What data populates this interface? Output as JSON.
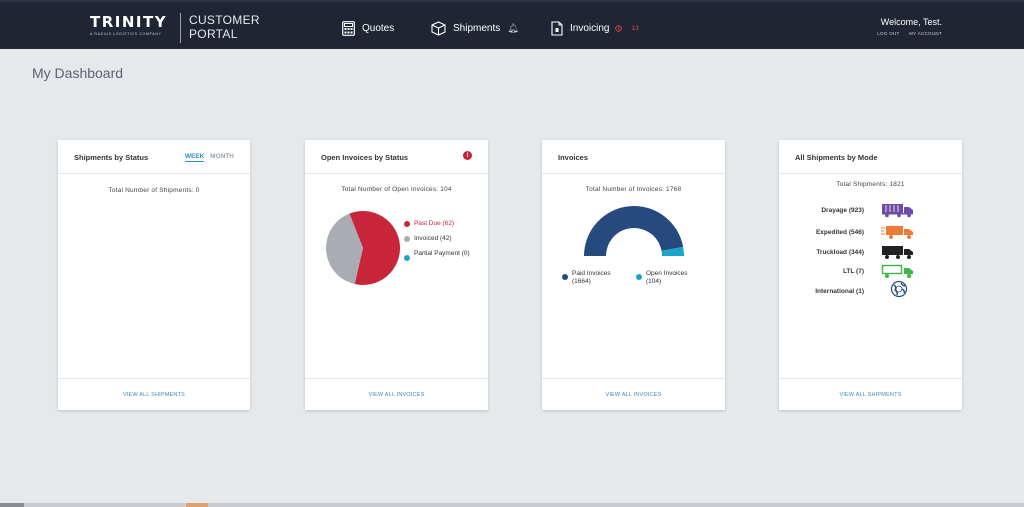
{
  "header": {
    "logo_word": "TRINITY",
    "logo_tagline": "A RADIUS LOGISTICS COMPANY",
    "portal_line1": "CUSTOMER",
    "portal_line2": "PORTAL",
    "nav": [
      {
        "label": "Quotes",
        "icon": "calculator-icon"
      },
      {
        "label": "Shipments",
        "icon": "box-icon"
      },
      {
        "label": "Invoicing",
        "icon": "document-icon",
        "badge": "13"
      }
    ],
    "welcome": "Welcome, Test.",
    "logout": "LOG OUT",
    "my_account": "MY ACCOUNT"
  },
  "page": {
    "title": "My Dashboard"
  },
  "cards": {
    "shipments_status": {
      "title": "Shipments by Status",
      "tab_week": "WEEK",
      "tab_month": "MONTH",
      "active_tab": "WEEK",
      "total": "Total Number of Shipments: 0",
      "footer": "VIEW ALL SHIPMENTS"
    },
    "open_invoices": {
      "title": "Open Invoices by Status",
      "alert": "!",
      "total": "Total Number of Open Invoices: 104",
      "legend": [
        {
          "label": "Past Due (62)",
          "color": "#c8243a"
        },
        {
          "label": "Invoiced (42)",
          "color": "#a9adb3"
        },
        {
          "label": "Partial Payment (0)",
          "color": "#1ba6c9"
        }
      ],
      "footer": "VIEW ALL INVOICES"
    },
    "invoices": {
      "title": "Invoices",
      "total": "Total Number of Invoices: 1768",
      "legend": [
        {
          "label": "Paid Invoices (1664)",
          "color": "#264a7e"
        },
        {
          "label": "Open Invoices (104)",
          "color": "#1ba6c9"
        }
      ],
      "footer": "VIEW ALL INVOICES"
    },
    "shipments_mode": {
      "title": "All Shipments by Mode",
      "total": "Total Shipments: 1821",
      "modes": [
        {
          "label": "Drayage (923)",
          "icon": "container-truck-icon",
          "color": "#6f4aa6"
        },
        {
          "label": "Expedited (546)",
          "icon": "expedited-truck-icon",
          "color": "#ef7a35"
        },
        {
          "label": "Truckload (344)",
          "icon": "truck-icon",
          "color": "#222222"
        },
        {
          "label": "LTL (7)",
          "icon": "ltl-truck-icon",
          "color": "#3bb84a"
        },
        {
          "label": "International (1)",
          "icon": "globe-icon",
          "color": "#264a7e"
        }
      ],
      "footer": "VIEW ALL SHIPMENTS"
    }
  },
  "chart_data": [
    {
      "type": "pie",
      "categories": [
        "Past Due",
        "Invoiced",
        "Partial Payment"
      ],
      "values": [
        62,
        42,
        0
      ],
      "colors": [
        "#c8243a",
        "#a9adb3",
        "#1ba6c9"
      ],
      "legend": "right"
    },
    {
      "type": "pie",
      "subtype": "half-donut",
      "categories": [
        "Paid Invoices",
        "Open Invoices"
      ],
      "values": [
        1664,
        104
      ],
      "colors": [
        "#264a7e",
        "#1ba6c9"
      ],
      "legend": "bottom"
    }
  ]
}
